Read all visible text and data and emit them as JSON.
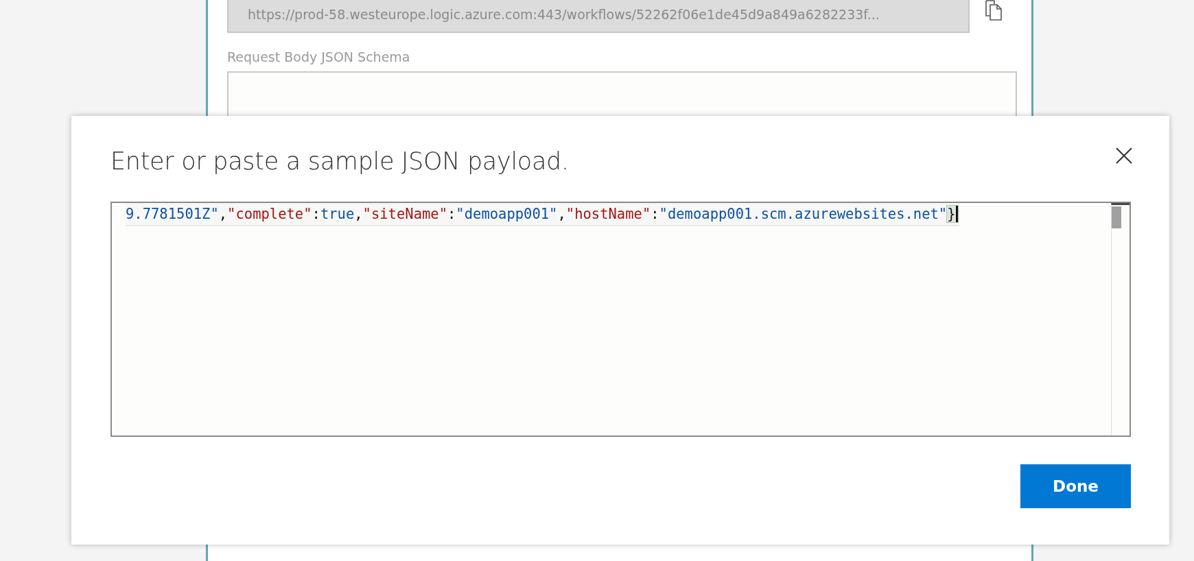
{
  "background_panel": {
    "url_field": {
      "value": "https://prod-58.westeurope.logic.azure.com:443/workflows/52262f06e1de45d9a849a6282233f..."
    },
    "schema_label": "Request Body JSON Schema"
  },
  "dialog": {
    "title": "Enter or paste a sample JSON payload.",
    "editor": {
      "tokens": [
        {
          "kind": "string",
          "text": "9.7781501Z\""
        },
        {
          "kind": "punct",
          "text": ","
        },
        {
          "kind": "key",
          "text": "\"complete\""
        },
        {
          "kind": "punct",
          "text": ":"
        },
        {
          "kind": "keyword",
          "text": "true"
        },
        {
          "kind": "punct",
          "text": ","
        },
        {
          "kind": "key",
          "text": "\"siteName\""
        },
        {
          "kind": "punct",
          "text": ":"
        },
        {
          "kind": "string",
          "text": "\"demoapp001\""
        },
        {
          "kind": "punct",
          "text": ","
        },
        {
          "kind": "key",
          "text": "\"hostName\""
        },
        {
          "kind": "punct",
          "text": ":"
        },
        {
          "kind": "string",
          "text": "\"demoapp001.scm.azurewebsites.net\""
        },
        {
          "kind": "brace-match",
          "text": "}"
        }
      ]
    },
    "done_button": "Done"
  }
}
